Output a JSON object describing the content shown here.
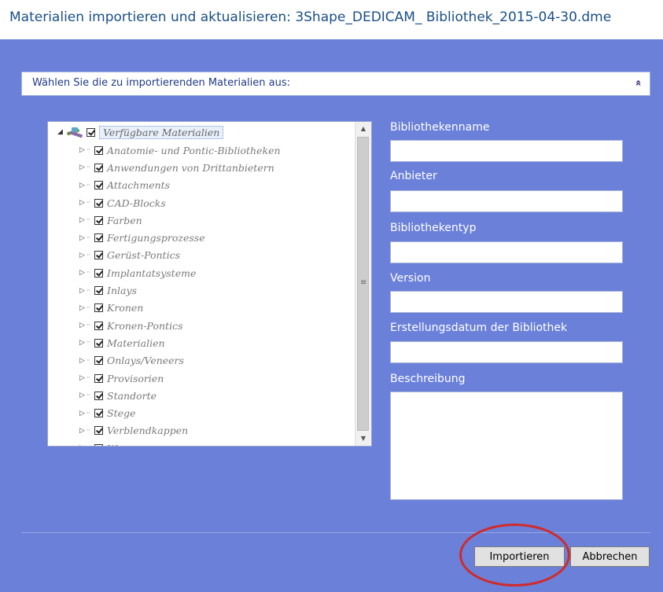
{
  "window": {
    "title": "Materialien importieren und aktualisieren: 3Shape_DEDICAM_ Bibliothek_2015-04-30.dme"
  },
  "section": {
    "header_label": "Wählen Sie die zu importierenden Materialien aus:",
    "collapse_icon": "double-chevron-up-icon",
    "collapse_glyph": "»"
  },
  "tree": {
    "root_label": "Verfügbare Materialien",
    "items": [
      {
        "label": "Anatomie- und Pontic-Bibliotheken",
        "checked": true
      },
      {
        "label": "Anwendungen von Drittanbietern",
        "checked": true
      },
      {
        "label": "Attachments",
        "checked": true
      },
      {
        "label": "CAD-Blocks",
        "checked": true
      },
      {
        "label": "Farben",
        "checked": true
      },
      {
        "label": "Fertigungsprozesse",
        "checked": true
      },
      {
        "label": "Gerüst-Pontics",
        "checked": true
      },
      {
        "label": "Implantatsysteme",
        "checked": true
      },
      {
        "label": "Inlays",
        "checked": true
      },
      {
        "label": "Kronen",
        "checked": true
      },
      {
        "label": "Kronen-Pontics",
        "checked": true
      },
      {
        "label": "Materialien",
        "checked": true
      },
      {
        "label": "Onlays/Veneers",
        "checked": true
      },
      {
        "label": "Provisorien",
        "checked": true
      },
      {
        "label": "Standorte",
        "checked": true
      },
      {
        "label": "Stege",
        "checked": true
      },
      {
        "label": "Verblendkappen",
        "checked": true
      },
      {
        "label": "Wax-ups",
        "checked": true
      }
    ],
    "scrollbar": {
      "up_glyph": "▲",
      "down_glyph": "▼",
      "grip_glyph": "≡"
    }
  },
  "form": {
    "library_name_label": "Bibliothekenname",
    "library_name_value": "",
    "provider_label": "Anbieter",
    "provider_value": "",
    "library_type_label": "Bibliothekentyp",
    "library_type_value": "",
    "version_label": "Version",
    "version_value": "",
    "creation_date_label": "Erstellungsdatum der Bibliothek",
    "creation_date_value": "",
    "description_label": "Beschreibung",
    "description_value": ""
  },
  "buttons": {
    "import_label": "Importieren",
    "cancel_label": "Abbrechen"
  },
  "colors": {
    "dialog_background": "#6b80d9",
    "annotation_ellipse": "#d12a2a"
  }
}
